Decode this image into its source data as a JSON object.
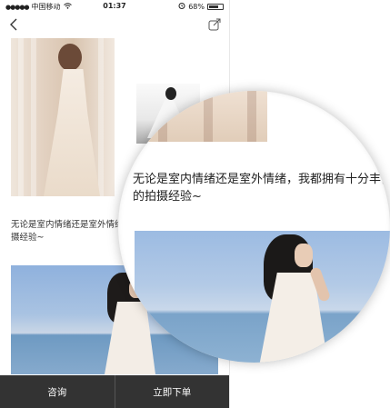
{
  "status_bar": {
    "carrier": "中国移动",
    "time": "01:37",
    "battery_percent": 0.68,
    "battery_label": "68%"
  },
  "nav": {
    "back_icon": "back-chevron-icon",
    "share_icon": "share-icon"
  },
  "photo_1": {
    "caption": ""
  },
  "content": {
    "text": "无论是室内情绪还是室外情绪，我都拥有十分丰富的拍摄经验~",
    "text_small_line1": "无论是室内情绪还是室外情绪，",
    "text_small_line2": "摄经验~"
  },
  "magnifier": {
    "text": "无论是室内情绪还是室外情绪，我都拥有十分丰富的拍摄经验~"
  },
  "bottom_bar": {
    "consult_label": "咨询",
    "order_label": "立即下单",
    "background": "#333333"
  }
}
